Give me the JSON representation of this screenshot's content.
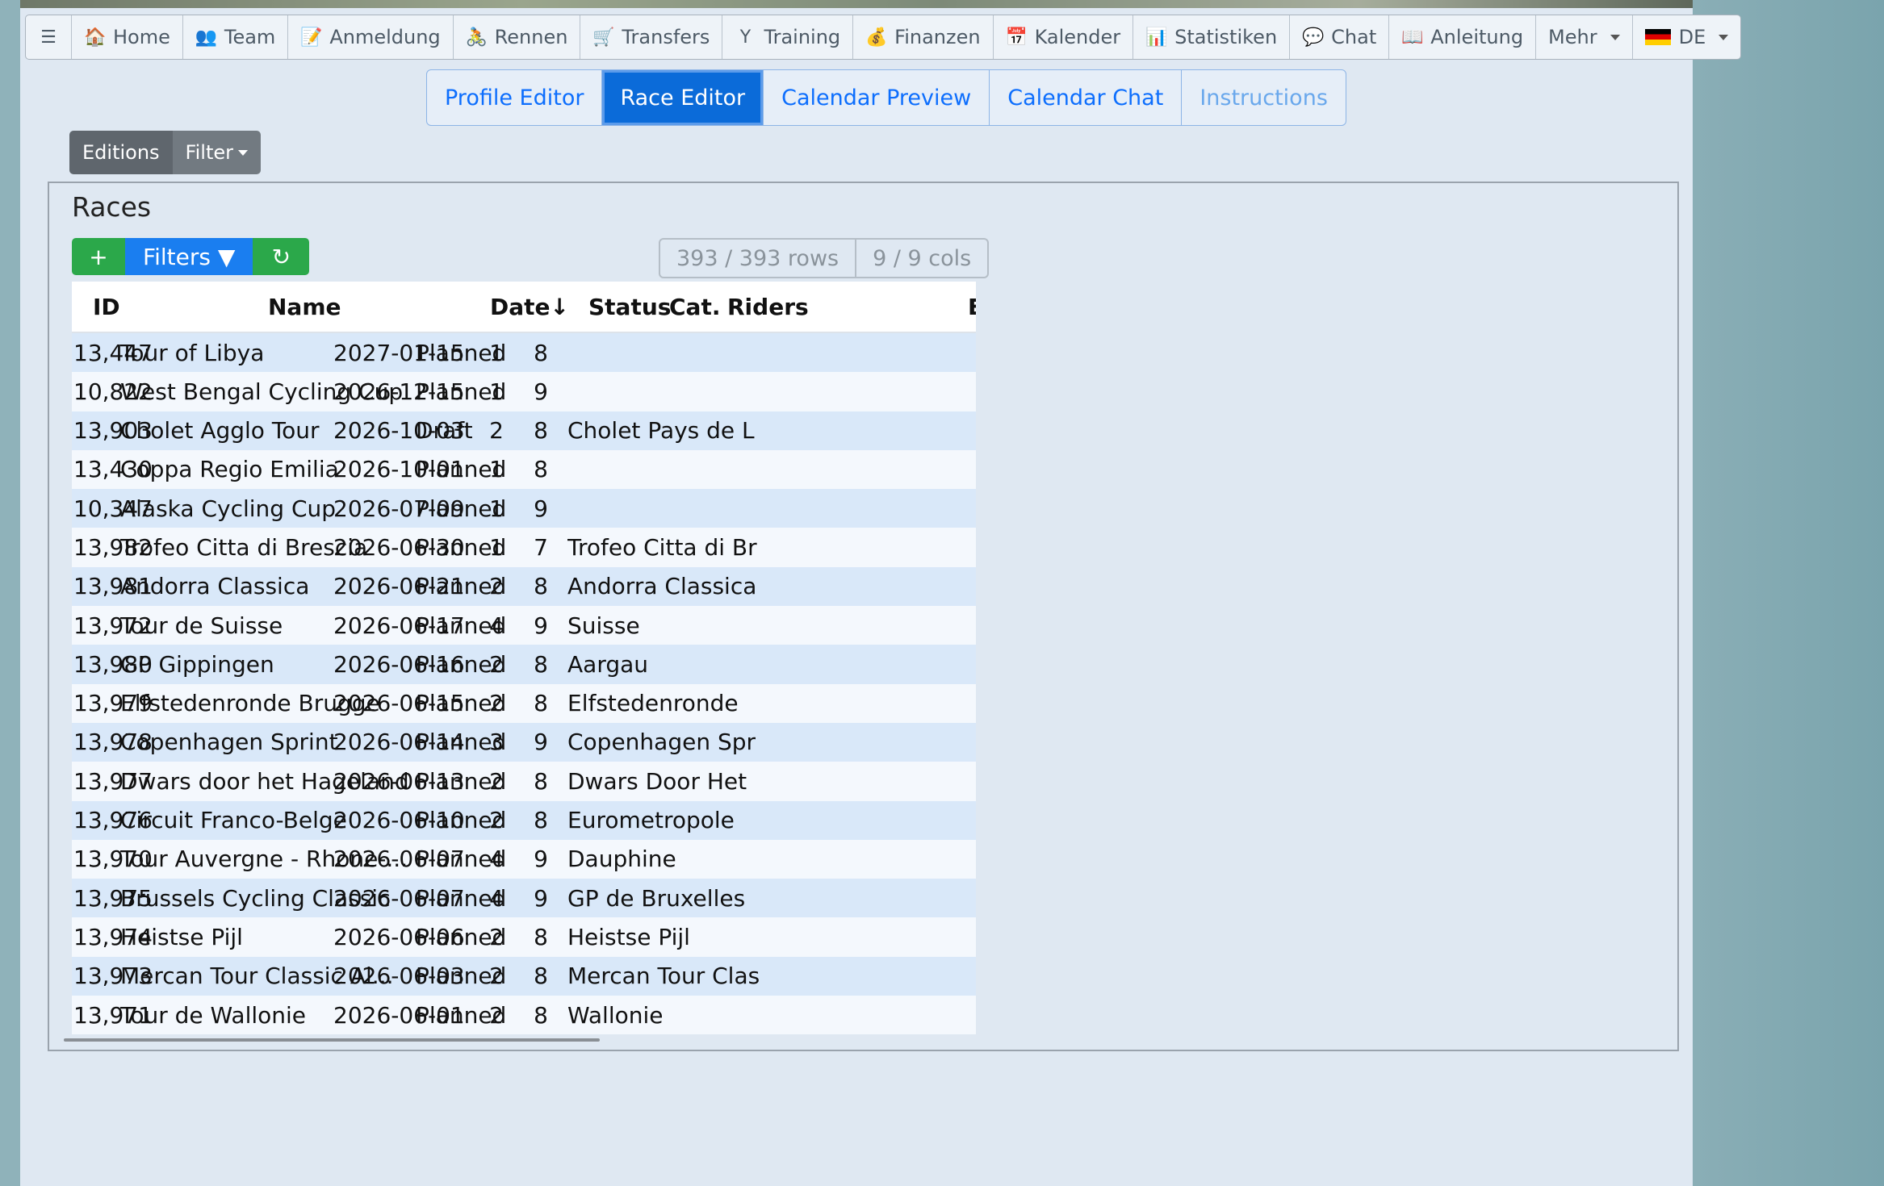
{
  "nav": {
    "items": [
      {
        "label": "Home",
        "icon": "house-icon",
        "glyph": "🏠"
      },
      {
        "label": "Team",
        "icon": "team-icon",
        "glyph": "👥"
      },
      {
        "label": "Anmeldung",
        "icon": "registration-icon",
        "glyph": "📝"
      },
      {
        "label": "Rennen",
        "icon": "cyclist-icon",
        "glyph": "🚴"
      },
      {
        "label": "Transfers",
        "icon": "cart-icon",
        "glyph": "🛒"
      },
      {
        "label": "Training",
        "icon": "training-icon",
        "glyph": "Y"
      },
      {
        "label": "Finanzen",
        "icon": "moneybag-icon",
        "glyph": "💰"
      },
      {
        "label": "Kalender",
        "icon": "calendar-icon",
        "glyph": "📅"
      },
      {
        "label": "Statistiken",
        "icon": "chart-icon",
        "glyph": "📊"
      },
      {
        "label": "Chat",
        "icon": "chat-icon",
        "glyph": "💬"
      },
      {
        "label": "Anleitung",
        "icon": "book-icon",
        "glyph": "📖"
      }
    ],
    "more_label": "Mehr",
    "lang_label": "DE",
    "menu_glyph": "☰"
  },
  "subtabs": [
    "Profile Editor",
    "Race Editor",
    "Calendar Preview",
    "Calendar Chat",
    "Instructions"
  ],
  "active_subtab": "Race Editor",
  "editions_label": "Editions",
  "filter_label": "Filter",
  "card_title": "Races",
  "toolbar": {
    "add": "+",
    "filters": "Filters ▼",
    "refresh": "↻"
  },
  "counts": {
    "rows": "393 / 393 rows",
    "cols": "9 / 9 cols"
  },
  "table": {
    "headers": {
      "id": "ID",
      "name": "Name",
      "date": "Date↓",
      "status": "Status",
      "cat": "Cat.",
      "riders": "Riders",
      "extra": "E"
    },
    "rows": [
      {
        "id": "13,447",
        "name": "Tour of Libya",
        "date": "2027-01-15",
        "status": "Planned",
        "cat": "1",
        "riders": "8",
        "extra": ""
      },
      {
        "id": "10,822",
        "name": "West Bengal Cycling Cup",
        "date": "2026-12-15",
        "status": "Planned",
        "cat": "1",
        "riders": "9",
        "extra": ""
      },
      {
        "id": "13,903",
        "name": "Cholet Agglo Tour",
        "date": "2026-10-03",
        "status": "Draft",
        "cat": "2",
        "riders": "8",
        "extra": "Cholet Pays de L"
      },
      {
        "id": "13,430",
        "name": "Coppa Regio Emilia",
        "date": "2026-10-01",
        "status": "Planned",
        "cat": "1",
        "riders": "8",
        "extra": ""
      },
      {
        "id": "10,347",
        "name": "Alaska Cycling Cup",
        "date": "2026-07-09",
        "status": "Planned",
        "cat": "1",
        "riders": "9",
        "extra": ""
      },
      {
        "id": "13,982",
        "name": "Trofeo Citta di Brescia",
        "date": "2026-06-30",
        "status": "Planned",
        "cat": "1",
        "riders": "7",
        "extra": "Trofeo Citta di Br"
      },
      {
        "id": "13,981",
        "name": "Andorra Classica",
        "date": "2026-06-21",
        "status": "Planned",
        "cat": "2",
        "riders": "8",
        "extra": "Andorra Classica"
      },
      {
        "id": "13,972",
        "name": "Tour de Suisse",
        "date": "2026-06-17",
        "status": "Planned",
        "cat": "4",
        "riders": "9",
        "extra": "Suisse"
      },
      {
        "id": "13,980",
        "name": "GP Gippingen",
        "date": "2026-06-16",
        "status": "Planned",
        "cat": "2",
        "riders": "8",
        "extra": "Aargau"
      },
      {
        "id": "13,979",
        "name": "Elfstedenronde Brugge",
        "date": "2026-06-15",
        "status": "Planned",
        "cat": "2",
        "riders": "8",
        "extra": "Elfstedenronde"
      },
      {
        "id": "13,978",
        "name": "Copenhagen Sprint",
        "date": "2026-06-14",
        "status": "Planned",
        "cat": "3",
        "riders": "9",
        "extra": "Copenhagen Spr"
      },
      {
        "id": "13,977",
        "name": "Dwars door het Hageland",
        "date": "2026-06-13",
        "status": "Planned",
        "cat": "2",
        "riders": "8",
        "extra": "Dwars Door Het"
      },
      {
        "id": "13,976",
        "name": "Circuit Franco-Belge",
        "date": "2026-06-10",
        "status": "Planned",
        "cat": "2",
        "riders": "8",
        "extra": "Eurometropole"
      },
      {
        "id": "13,970",
        "name": "Tour Auvergne - Rhone-...",
        "date": "2026-06-07",
        "status": "Planned",
        "cat": "4",
        "riders": "9",
        "extra": "Dauphine"
      },
      {
        "id": "13,975",
        "name": "Brussels Cycling Classic",
        "date": "2026-06-07",
        "status": "Planned",
        "cat": "4",
        "riders": "9",
        "extra": "GP de Bruxelles"
      },
      {
        "id": "13,974",
        "name": "Heistse Pijl",
        "date": "2026-06-06",
        "status": "Planned",
        "cat": "2",
        "riders": "8",
        "extra": "Heistse Pijl"
      },
      {
        "id": "13,973",
        "name": "Mercan Tour Classic Al...",
        "date": "2026-06-03",
        "status": "Planned",
        "cat": "2",
        "riders": "8",
        "extra": "Mercan Tour Clas"
      },
      {
        "id": "13,971",
        "name": "Tour de Wallonie",
        "date": "2026-06-01",
        "status": "Planned",
        "cat": "2",
        "riders": "8",
        "extra": "Wallonie"
      }
    ]
  }
}
